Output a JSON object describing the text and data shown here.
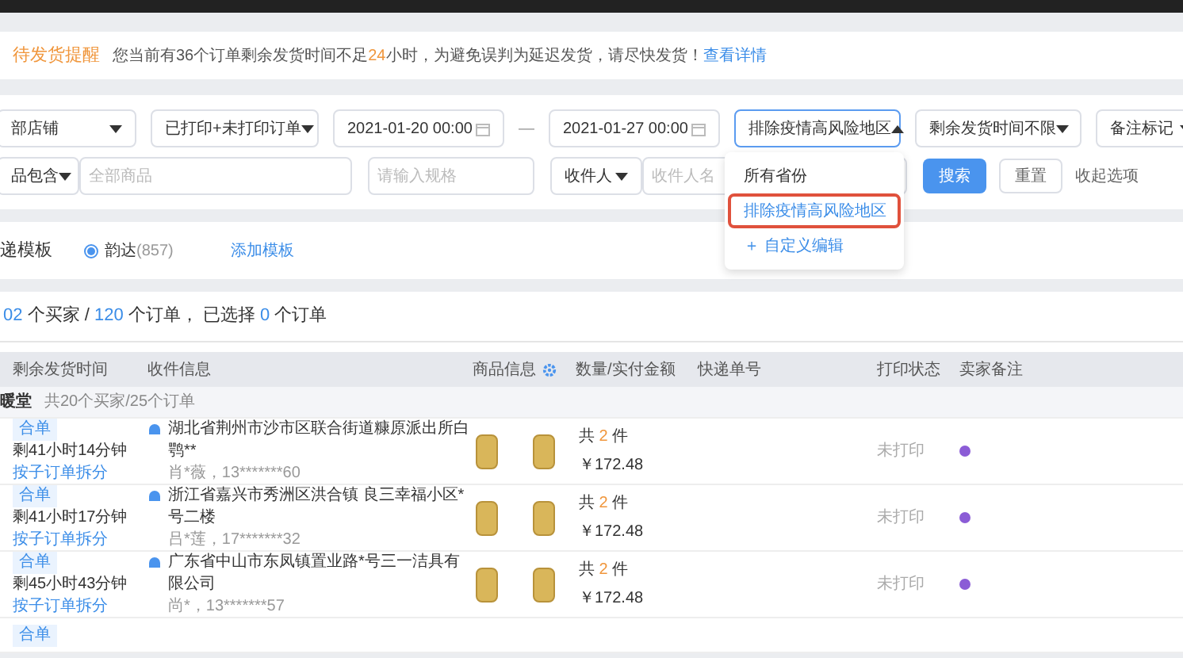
{
  "notice": {
    "label": "待发货提醒",
    "before": "您当前有36个订单剩余发货时间不足",
    "hours": "24",
    "after": "小时，为避免误判为延迟发货，请尽快发货！",
    "link": "查看详情"
  },
  "filters": {
    "row1": [
      {
        "kind": "select",
        "value": "部店铺",
        "open": false
      },
      {
        "kind": "select",
        "value": "已打印+未打印订单",
        "open": false
      },
      {
        "kind": "date",
        "value": "2021-01-20 00:00"
      },
      {
        "kind": "dash",
        "value": "—"
      },
      {
        "kind": "date",
        "value": "2021-01-27 00:00"
      },
      {
        "kind": "select",
        "value": "排除疫情高风险地区",
        "open": true
      },
      {
        "kind": "select",
        "value": "剩余发货时间不限",
        "open": false
      },
      {
        "kind": "select",
        "value": "备注标记",
        "open": false
      }
    ],
    "row2": [
      {
        "kind": "select",
        "value": "品包含",
        "open": false
      },
      {
        "kind": "input",
        "placeholder": "全部商品"
      },
      {
        "kind": "input",
        "placeholder": "请输入规格"
      },
      {
        "kind": "select",
        "value": "收件人",
        "open": false
      },
      {
        "kind": "input",
        "placeholder": "收件人名"
      }
    ],
    "search_button": "搜索",
    "reset_button": "重置",
    "collapse_link": "收起选项"
  },
  "dropdown": {
    "items": [
      {
        "kind": "option",
        "label": "所有省份",
        "selected": false,
        "outlined": false
      },
      {
        "kind": "option",
        "label": "排除疫情高风险地区",
        "selected": true,
        "outlined": true
      },
      {
        "kind": "action",
        "label": "＋ 自定义编辑"
      }
    ]
  },
  "template": {
    "label": "递模板",
    "options": [
      {
        "name": "韵达",
        "count": "(857)",
        "selected": true
      }
    ],
    "add_link": "添加模板"
  },
  "summary": {
    "buyers": "02",
    "buyers_unit": " 个买家 / ",
    "orders": "120",
    "orders_unit": " 个订单， 已选择 ",
    "selected_count": "0",
    "selected_unit": " 个订单"
  },
  "table": {
    "columns": [
      "剩余发货时间",
      "收件信息",
      "商品信息",
      "数量/实付金额",
      "快递单号",
      "打印状态",
      "卖家备注"
    ],
    "group": {
      "name": "暖堂",
      "info": "共20个买家/25个订单"
    },
    "rows": [
      {
        "tag": "合单",
        "remaining": "剩41小时14分钟",
        "split_link": "按子订单拆分",
        "address": "湖北省荆州市沙市区联合街道糠原派出所白鹗**",
        "contact": "肖*薇，13*******60",
        "quantity_prefix": "共",
        "quantity": "2",
        "quantity_suffix": "件",
        "amount": "￥172.48",
        "print_status": "未打印",
        "color": "#8b5cd6"
      },
      {
        "tag": "合单",
        "remaining": "剩41小时17分钟",
        "split_link": "按子订单拆分",
        "address": "浙江省嘉兴市秀洲区洪合镇 良三幸福小区*号二楼",
        "contact": "吕*莲，17*******32",
        "quantity_prefix": "共",
        "quantity": "2",
        "quantity_suffix": "件",
        "amount": "￥172.48",
        "print_status": "未打印",
        "color": "#8b5cd6"
      },
      {
        "tag": "合单",
        "remaining": "剩45小时43分钟",
        "split_link": "按子订单拆分",
        "address": "广东省中山市东凤镇置业路*号三一洁具有限公司",
        "contact": "尚*，13*******57",
        "quantity_prefix": "共",
        "quantity": "2",
        "quantity_suffix": "件",
        "amount": "￥172.48",
        "print_status": "未打印",
        "color": "#8b5cd6"
      },
      {
        "tag": "合单"
      }
    ]
  }
}
